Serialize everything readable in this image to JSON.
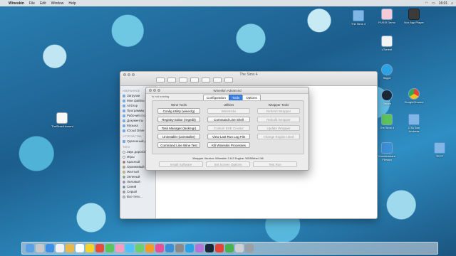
{
  "menubar": {
    "app_name": "Wineskin",
    "items": [
      "File",
      "Edit",
      "Window",
      "Help"
    ],
    "clock": "16:01"
  },
  "desktop_icons": [
    {
      "label": "The Sims 4",
      "kind": "folder"
    },
    {
      "label": "PUSSI Demo",
      "kind": "app"
    },
    {
      "label": "Nox App Player",
      "kind": "app"
    },
    {
      "label": "uTorrent",
      "kind": "app"
    },
    {
      "label": "Skype",
      "kind": "app"
    },
    {
      "label": "GoogleChrome",
      "kind": "app"
    },
    {
      "label": "Steam",
      "kind": "app"
    },
    {
      "label": "The Sims 4",
      "kind": "app"
    },
    {
      "label": "GTA San Andreas",
      "kind": "folder"
    },
    {
      "label": "Wondershare Filmora",
      "kind": "app"
    },
    {
      "label": "ТЕСТ",
      "kind": "folder"
    },
    {
      "label": "TheSims4.torrent",
      "kind": "file"
    }
  ],
  "finder": {
    "title": "The Sims 4",
    "sidebar": {
      "favorites_header": "ИЗБРАННОЕ",
      "favorites": [
        "Загрузки",
        "Мои файлы",
        "AirDrop",
        "Программы",
        "Рабочий стол",
        "Документы",
        "Музыка",
        "iCloud Drive"
      ],
      "devices_header": "УСТРОЙСТВА",
      "devices": [
        "Удаленный диск"
      ],
      "tags_header": "ТЕГИ",
      "tags": [
        {
          "label": "Звук дорогой",
          "color": "#ffffff"
        },
        {
          "label": "Игры",
          "color": "#ffffff"
        },
        {
          "label": "Красный",
          "color": "#e64b3c"
        },
        {
          "label": "Оранжевый",
          "color": "#f39c25"
        },
        {
          "label": "Желтый",
          "color": "#f5d328"
        },
        {
          "label": "Зеленый",
          "color": "#5bc45b"
        },
        {
          "label": "Лиловый",
          "color": "#b476d8"
        },
        {
          "label": "Синий",
          "color": "#3c8ee6"
        },
        {
          "label": "Серый",
          "color": "#9b9b9b"
        },
        {
          "label": "Все теги…",
          "color": "#cccccc"
        }
      ]
    }
  },
  "wineskin": {
    "title": "Wineskin Advanced",
    "status": "Is not running",
    "tabs": [
      "Configuration",
      "Tools",
      "Options"
    ],
    "active_tab": "Tools",
    "columns": {
      "wine_tools": {
        "header": "Wine Tools",
        "buttons": [
          "Config Utility (winecfg)",
          "Registry Editor (regedit)",
          "Task Manager (taskmgr)",
          "Uninstaller (uninstaller)",
          "Command Line Wine Test"
        ]
      },
      "utilities": {
        "header": "Utilities",
        "buttons": [
          "Winetricks",
          "Command Line Shell",
          "Custom EXE Creator",
          "View Last Run Log File",
          "Kill Wineskin Processes"
        ]
      },
      "wrapper_tools": {
        "header": "Wrapper Tools",
        "buttons": [
          "Refresh Wrapper",
          "Rebuild Wrapper",
          "Update Wrapper",
          "Change Engine Used"
        ]
      }
    },
    "version_line": "Wrapper Version: Wineskin 2.6.2       Engine: WS9Wine1.56",
    "bottom_buttons": [
      "Install Software",
      "Set Screen Options",
      "Test Run"
    ]
  }
}
